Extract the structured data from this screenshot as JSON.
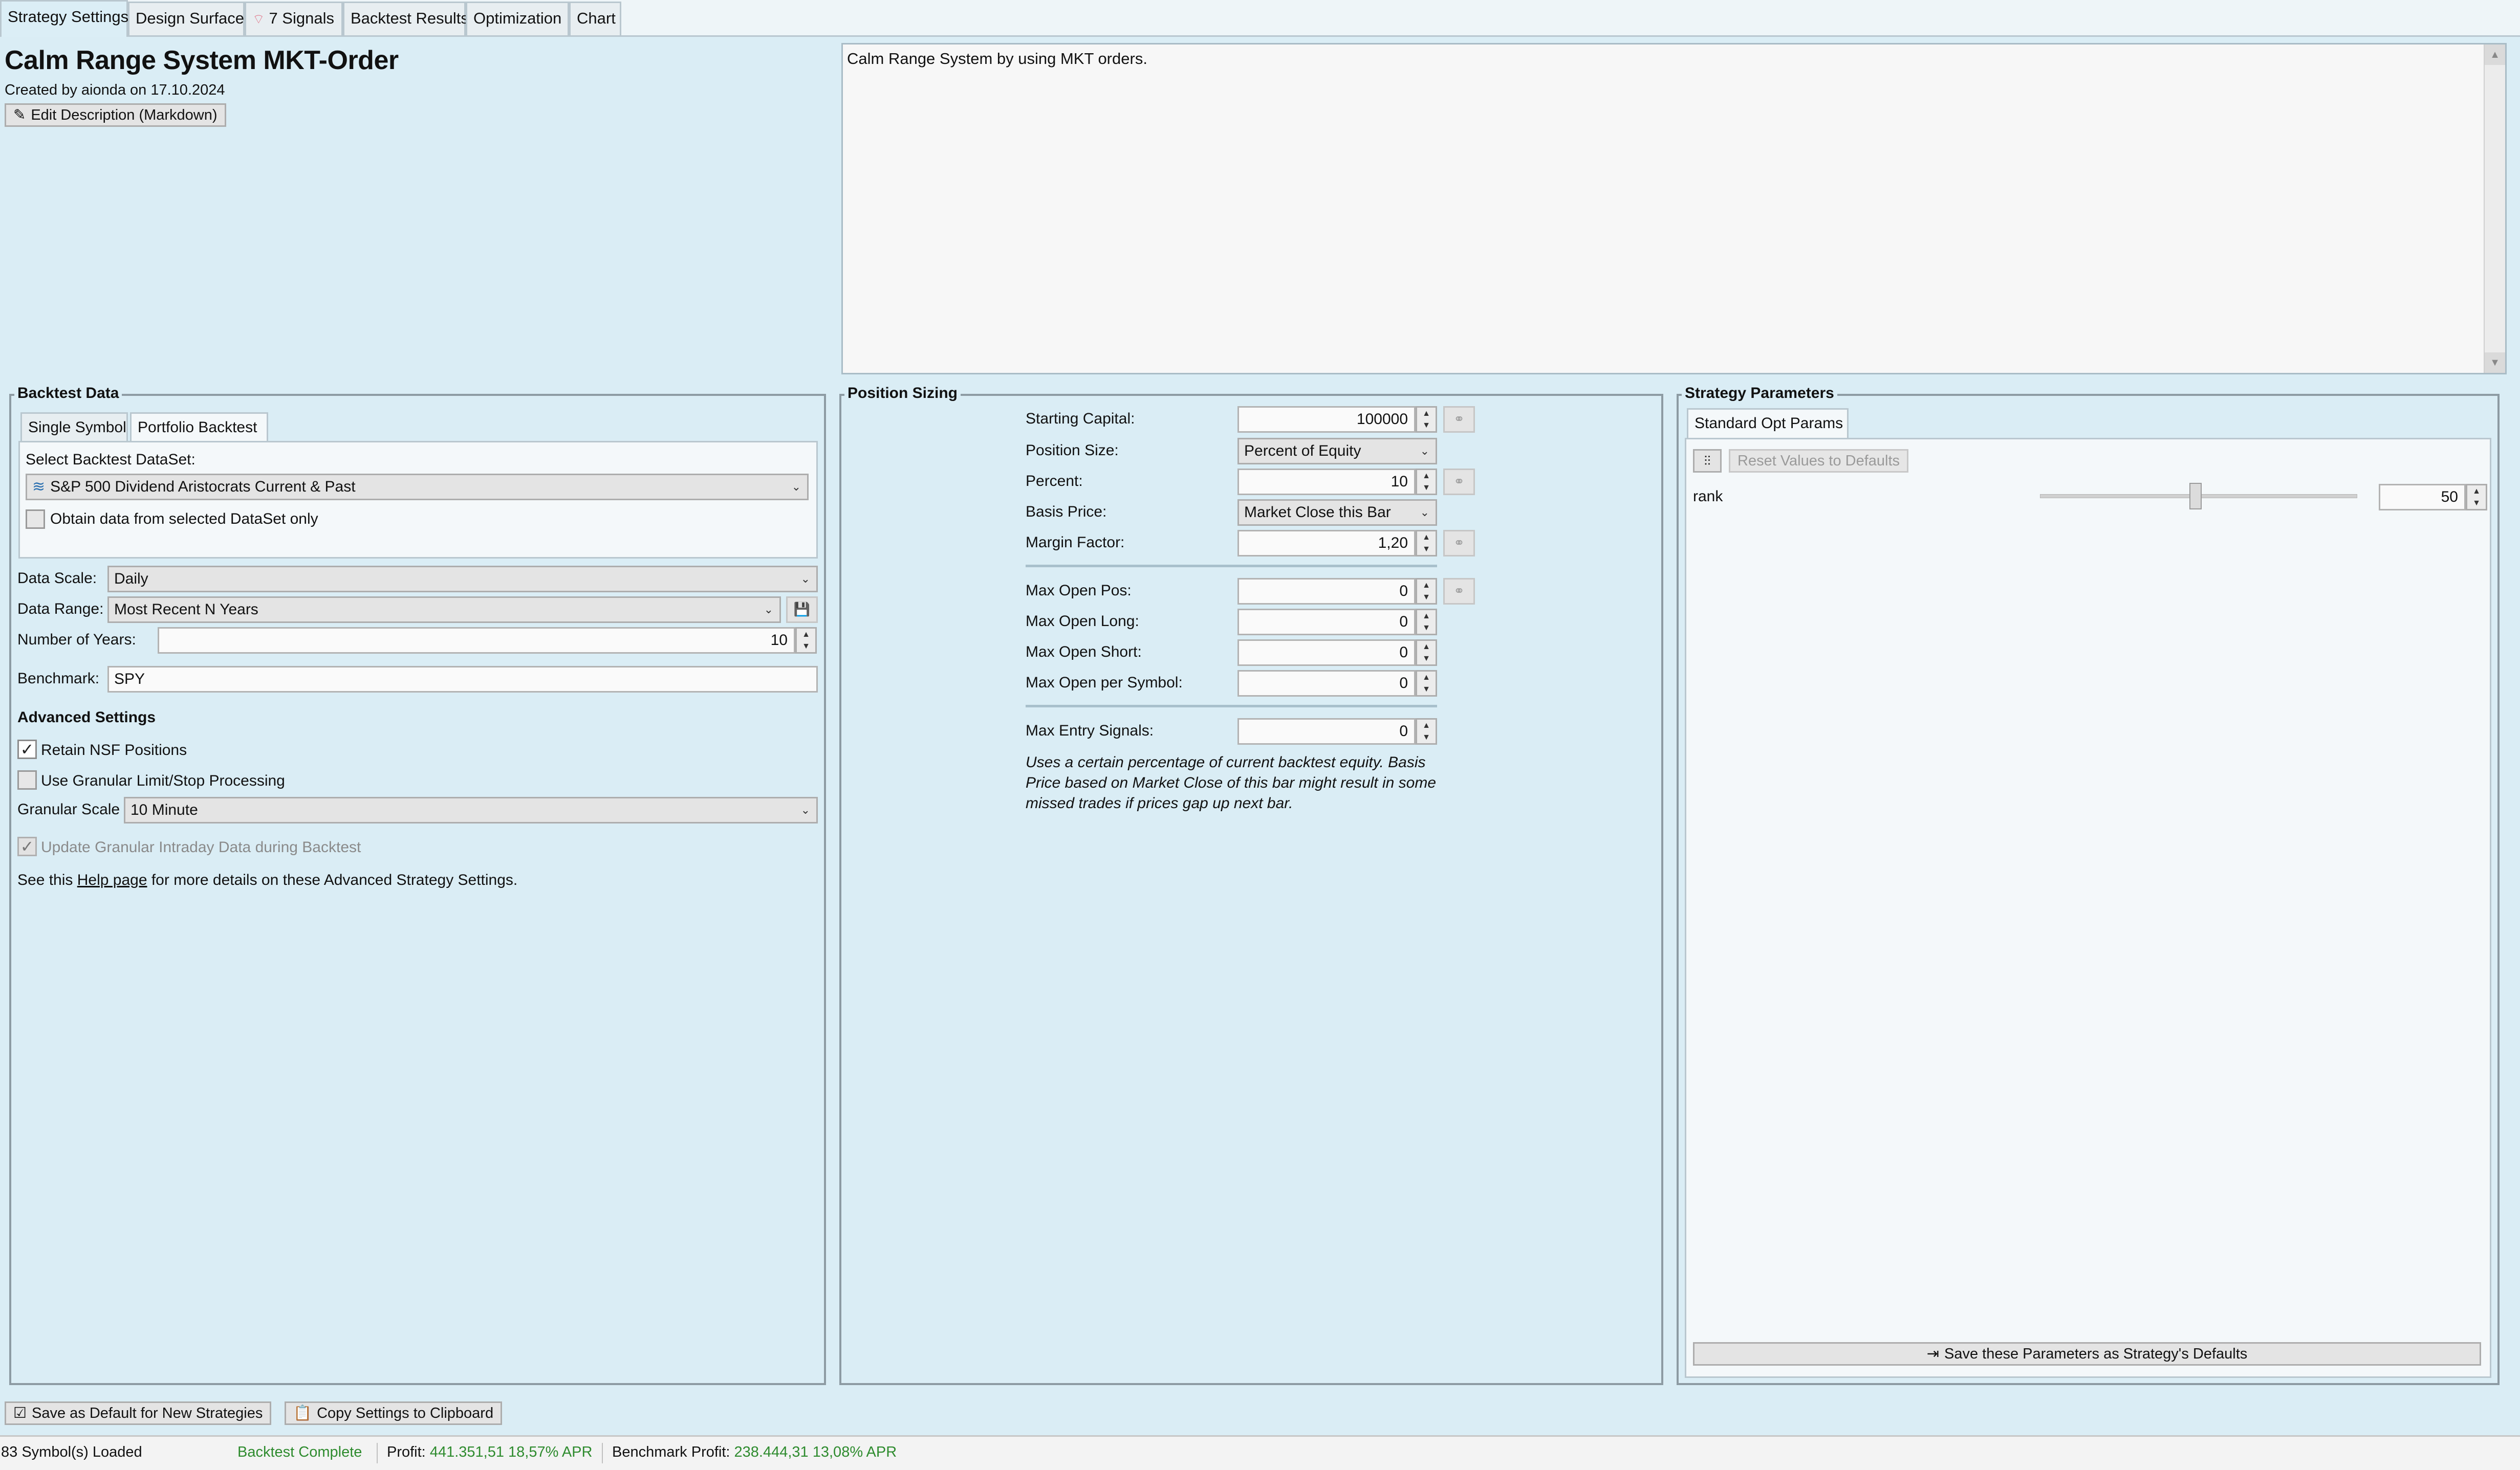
{
  "tabs": [
    {
      "label": "Strategy Settings"
    },
    {
      "label": "Design Surface"
    },
    {
      "label": "7 Signals"
    },
    {
      "label": "Backtest Results"
    },
    {
      "label": "Optimization"
    },
    {
      "label": "Chart"
    }
  ],
  "header": {
    "title": "Calm Range System MKT-Order",
    "created": "Created by aionda on 17.10.2024",
    "edit_button": "Edit Description (Markdown)",
    "description": "Calm Range System by using MKT orders."
  },
  "backtest_data": {
    "group_title": "Backtest Data",
    "tabs": [
      "Single Symbol",
      "Portfolio Backtest"
    ],
    "select_label": "Select Backtest DataSet:",
    "dataset": "S&P 500 Dividend Aristocrats Current & Past",
    "obtain_label": "Obtain data from selected DataSet only",
    "data_scale_label": "Data Scale:",
    "data_scale": "Daily",
    "data_range_label": "Data Range:",
    "data_range": "Most Recent N Years",
    "years_label": "Number of Years:",
    "years": "10",
    "benchmark_label": "Benchmark:",
    "benchmark": "SPY",
    "advanced_title": "Advanced Settings",
    "retain_nsf": "Retain NSF Positions",
    "retain_nsf_checked": true,
    "granular_processing": "Use Granular Limit/Stop Processing",
    "granular_processing_checked": false,
    "granular_scale_label": "Granular Scale",
    "granular_scale": "10 Minute",
    "update_granular": "Update Granular Intraday Data during Backtest",
    "update_granular_checked": true,
    "help_prefix": "See this ",
    "help_link": "Help page",
    "help_suffix": " for more details on these Advanced Strategy Settings."
  },
  "position_sizing": {
    "group_title": "Position Sizing",
    "starting_capital_label": "Starting Capital:",
    "starting_capital": "100000",
    "position_size_label": "Position Size:",
    "position_size": "Percent of Equity",
    "percent_label": "Percent:",
    "percent": "10",
    "basis_price_label": "Basis Price:",
    "basis_price": "Market Close this Bar",
    "margin_label": "Margin Factor:",
    "margin": "1,20",
    "max_open_pos_label": "Max Open Pos:",
    "max_open_pos": "0",
    "max_open_long_label": "Max Open Long:",
    "max_open_long": "0",
    "max_open_short_label": "Max Open Short:",
    "max_open_short": "0",
    "max_open_symbol_label": "Max Open per Symbol:",
    "max_open_symbol": "0",
    "max_entry_label": "Max Entry Signals:",
    "max_entry": "0",
    "note_line1": "Uses a certain percentage of current backtest equity. Basis",
    "note_line2": "Price based on Market Close of this bar might result in some",
    "note_line3": "missed trades if prices gap up next bar."
  },
  "strategy_parameters": {
    "group_title": "Strategy Parameters",
    "tab": "Standard Opt Params",
    "reset_button": "Reset Values to Defaults",
    "param_name": "rank",
    "param_value": "50",
    "slider_level": 0.49,
    "save_button": "Save these Parameters as Strategy's Defaults"
  },
  "bottom_buttons": {
    "save_default": "Save as Default for New Strategies",
    "copy_settings": "Copy Settings to Clipboard"
  },
  "status": {
    "symbols": "83 Symbol(s) Loaded",
    "backtest": "Backtest Complete",
    "profit_label": "Profit:",
    "profit_value": "441.351,51 18,57% APR",
    "benchmark_label": "Benchmark Profit:",
    "benchmark_value": "238.444,31 13,08% APR"
  },
  "icons": {
    "edit": "edit-icon",
    "dataset": "dataset-icon",
    "signals": "wifi-signal-icon",
    "save": "floppy-disk-icon",
    "lock": "link-icon",
    "sliders": "sliders-icon",
    "checkbox": "checkbox-icon",
    "clipboard": "clipboard-icon",
    "arrow-to-line": "arrow-to-line-icon"
  }
}
